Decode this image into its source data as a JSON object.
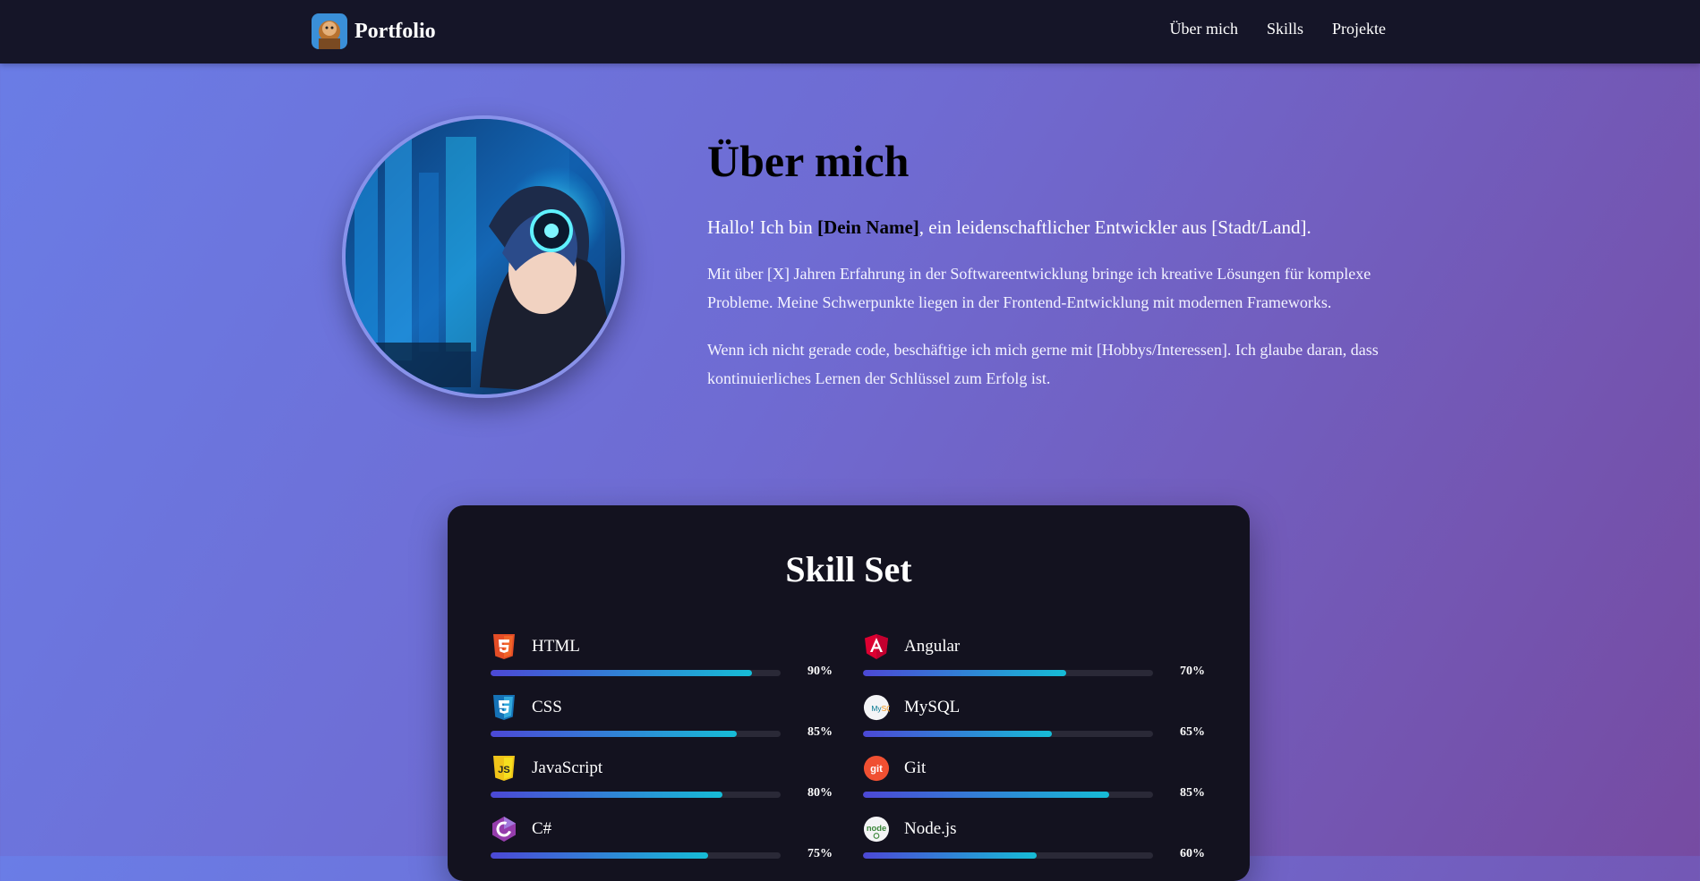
{
  "nav": {
    "brand": "Portfolio",
    "links": [
      "Über mich",
      "Skills",
      "Projekte"
    ]
  },
  "about": {
    "title": "Über mich",
    "intro_pre": "Hallo! Ich bin ",
    "intro_name": "[Dein Name]",
    "intro_post": ", ein leidenschaftlicher Entwickler aus [Stadt/Land].",
    "p1": "Mit über [X] Jahren Erfahrung in der Softwareentwicklung bringe ich kreative Lösungen für komplexe Probleme. Meine Schwerpunkte liegen in der Frontend-Entwicklung mit modernen Frameworks.",
    "p2": "Wenn ich nicht gerade code, beschäftige ich mich gerne mit [Hobbys/Interessen]. Ich glaube daran, dass kontinuierliches Lernen der Schlüssel zum Erfolg ist."
  },
  "skills": {
    "title": "Skill Set",
    "left": [
      {
        "name": "HTML",
        "percent": 90,
        "percent_label": "90%",
        "icon": "html5-icon",
        "color": "#e44d26"
      },
      {
        "name": "CSS",
        "percent": 85,
        "percent_label": "85%",
        "icon": "css3-icon",
        "color": "#2965f1"
      },
      {
        "name": "JavaScript",
        "percent": 80,
        "percent_label": "80%",
        "icon": "javascript-icon",
        "color": "#f7df1e"
      },
      {
        "name": "C#",
        "percent": 75,
        "percent_label": "75%",
        "icon": "csharp-icon",
        "color": "#953dac"
      }
    ],
    "right": [
      {
        "name": "Angular",
        "percent": 70,
        "percent_label": "70%",
        "icon": "angular-icon",
        "color": "#dd0031"
      },
      {
        "name": "MySQL",
        "percent": 65,
        "percent_label": "65%",
        "icon": "mysql-icon",
        "color": "#00758f"
      },
      {
        "name": "Git",
        "percent": 85,
        "percent_label": "85%",
        "icon": "git-icon",
        "color": "#f05032"
      },
      {
        "name": "Node.js",
        "percent": 60,
        "percent_label": "60%",
        "icon": "nodejs-icon",
        "color": "#3c873a"
      }
    ]
  }
}
